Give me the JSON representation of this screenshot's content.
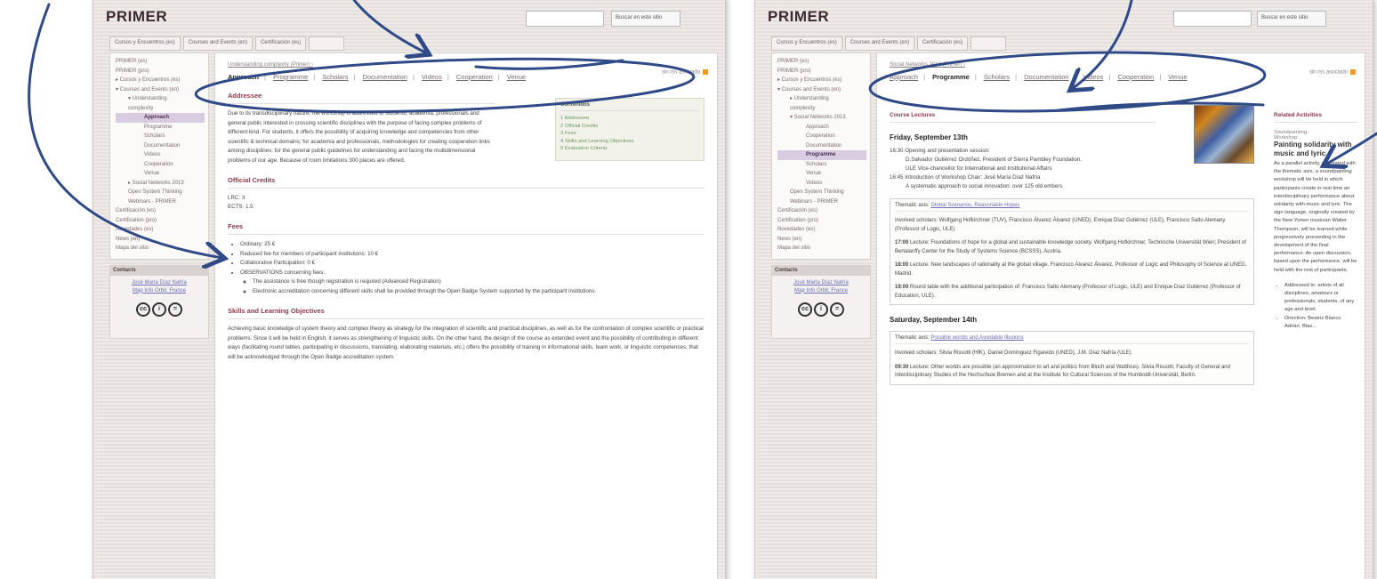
{
  "left": {
    "brand": "PRIMER",
    "search_select": "Buscar en este sitio",
    "top_tabs": [
      "Cursos y Encuentros (es)",
      "Courses and Events (en)",
      "Certificación (es)",
      ""
    ],
    "nav": [
      {
        "label": "PRIMER (es)",
        "level": 1
      },
      {
        "label": "PRIMER (pro)",
        "level": 1
      },
      {
        "label": "▸ Cursos y Encuentros (es)",
        "level": 1
      },
      {
        "label": "▾ Courses and Events (en)",
        "level": 1
      },
      {
        "label": "▾ Understanding",
        "level": 2
      },
      {
        "label": "complexity",
        "level": 2
      },
      {
        "label": "Approach",
        "level": 3,
        "active": true
      },
      {
        "label": "Programme",
        "level": 3
      },
      {
        "label": "Scholars",
        "level": 3
      },
      {
        "label": "Documentation",
        "level": 3
      },
      {
        "label": "Videos",
        "level": 3
      },
      {
        "label": "Cooperation",
        "level": 3
      },
      {
        "label": "Venue",
        "level": 3
      },
      {
        "label": "▸ Social Networks 2013",
        "level": 2
      },
      {
        "label": "Open System Thinking",
        "level": 2
      },
      {
        "label": "Webinars - PRIMER",
        "level": 2
      },
      {
        "label": "Certificación (es)",
        "level": 1
      },
      {
        "label": "Certification (pro)",
        "level": 1
      },
      {
        "label": "Novedades (es)",
        "level": 1
      },
      {
        "label": "News (en)",
        "level": 1
      },
      {
        "label": "Mapa del sitio",
        "level": 1
      }
    ],
    "contacts_title": "Contacts",
    "contacts_links": [
      "José María Díaz Nafría",
      "Map Info Orbit, France"
    ],
    "breadcrumb": "Understanding complexity (Primer) ›",
    "rss": "sin rss asociado",
    "subnav": [
      "Approach",
      "Programme",
      "Scholars",
      "Documentation",
      "Videos",
      "Cooperation",
      "Venue"
    ],
    "sections": {
      "addressee_h": "Addressee",
      "addressee_text": "Due to its transdisciplinary nature, the workshop is addressed to students, academia, professionals and general public interested in crossing scientific disciplines with the purpose of facing complex problems of different kind. For students, it offers the possibility of acquiring knowledge and competencies from other scientific & technical domains; for academia and professionals, methodologies for creating cooperation links among disciplines; for the general public guidelines for understanding and facing the multidimensional problems of our age. Because of room limitations 300 places are offered.",
      "credits_h": "Official Credits",
      "credits_lines": [
        "LRC: 3",
        "ECTS: 1.5"
      ],
      "fees_h": "Fees",
      "fees_items": [
        "Ordinary: 25 €",
        "Reduced fee for members of participant institutions: 10 €",
        "Collaborative Participation: 0 €",
        "OBSERVATIONS concerning fees:"
      ],
      "fees_sub": [
        "The assistance is free though registration is required (Advanced Registration)",
        "Electronic accreditation concerning different skills shall be provided through the Open Badge System supported by the participant institutions."
      ],
      "skills_h": "Skills and Learning Objectives",
      "skills_text": "Achieving basic knowledge of system theory and complex theory as strategy for the integration of scientific and practical disciplines, as well as for the confrontation of complex scientific or practical problems. Since it will be held in English, it serves as strengthening of linguistic skills. On the other hand, the design of the course as extended event and the possibility of contributing in different ways (facilitating round tables, participating in discussions, translating, elaborating materials, etc.) offers the possibility of training in informational skills, team work, or linguistic competences, that will be acknowledged through the Open Badge accreditation system."
    },
    "toc": {
      "title": "Contenidos",
      "items": [
        "1 Addressee",
        "2 Official Credits",
        "3 Fees",
        "4 Skills and Learning Objectives",
        "5 Evaluation Criteria"
      ]
    }
  },
  "right": {
    "brand": "PRIMER",
    "search_select": "Buscar en este sitio",
    "top_tabs": [
      "Cursos y Encuentros (es)",
      "Courses and Events (en)",
      "Certificación (es)",
      ""
    ],
    "nav": [
      {
        "label": "PRIMER (es)",
        "level": 1
      },
      {
        "label": "PRIMER (pro)",
        "level": 1
      },
      {
        "label": "▸ Cursos y Encuentros (es)",
        "level": 1
      },
      {
        "label": "▾ Courses and Events (en)",
        "level": 1
      },
      {
        "label": "▸ Understanding",
        "level": 2
      },
      {
        "label": "complexity",
        "level": 2
      },
      {
        "label": "▾ Social Networks 2013",
        "level": 2
      },
      {
        "label": "Approach",
        "level": 3
      },
      {
        "label": "Cooperation",
        "level": 3
      },
      {
        "label": "Documentation",
        "level": 3
      },
      {
        "label": "Programme",
        "level": 3,
        "active": true
      },
      {
        "label": "Scholars",
        "level": 3
      },
      {
        "label": "Venue",
        "level": 3
      },
      {
        "label": "Videos",
        "level": 3
      },
      {
        "label": "Open System Thinking",
        "level": 2
      },
      {
        "label": "Webinars - PRIMER",
        "level": 2
      },
      {
        "label": "Certificación (es)",
        "level": 1
      },
      {
        "label": "Certification (pro)",
        "level": 1
      },
      {
        "label": "Novedades (es)",
        "level": 1
      },
      {
        "label": "News (en)",
        "level": 1
      },
      {
        "label": "Mapa del sitio",
        "level": 1
      }
    ],
    "contacts_title": "Contacts",
    "contacts_links": [
      "José María Díaz Nafría",
      "Map Info Orbit, France"
    ],
    "breadcrumb": "Social Networks 2013 (Primer) ›",
    "rss": "sin rss asociado",
    "subnav": [
      "Approach",
      "Programme",
      "Scholars",
      "Documentation",
      "Videos",
      "Cooperation",
      "Venue"
    ],
    "course_lectures_h": "Course Lectures",
    "friday_h": "Friday, September 13th",
    "friday_lines": [
      "16:30 Opening and presentation session:",
      "D.Salvador Gutiérrez Ordóñez, President of Sierra Pambley Foundation.",
      "ULE Vice-chancellor for International and Institutional Affairs",
      "16:45 Introduction of Workshop Chair: José María Díaz Nafría",
      "A systematic approach to social innovation: over 125 old embers"
    ],
    "box1": {
      "theme_label": "Thematic axis:",
      "theme_link": "Global Scenarios, Reasonable Hopes",
      "p1": "Involved scholars: Wolfgang Hofkirchner (TUV), Francisco Álvarez Álvarez (UNED), Enrique Díaz Gutiérrez (ULE), Francisco Salto Alemany (Professor of Logic, ULE)",
      "p2_time": "17:00",
      "p2": "Lecture: Foundations of hope for a global and sustainable knowledge society. Wolfgang Hofkirchner, Technische Universität Wien; President of Bertalanffy Center for the Study of Systems Science (BCSSS), Austria.",
      "p3_time": "18:00",
      "p3": "Lecture: New landscapes of rationality at the global village. Francisco Álvarez Álvarez, Professor of Logic and Philosophy of Science at UNED, Madrid.",
      "p4_time": "19:00",
      "p4": "Round table with the additional participation of: Francisco Salto Alemany (Professor of Logic, ULE) and Enrique Díaz Gutiérrez (Professor of Education, ULE)."
    },
    "saturday_h": "Saturday, September 14th",
    "box2": {
      "theme_label": "Thematic axis:",
      "theme_link": "Possible worlds and Avoidable Illusions",
      "p1": "Involved scholars: Silvia Rissotti (HfK), Daniel Domínguez Figaredo (UNED), J.M. Díaz Nafría (ULE)",
      "p2_time": "09:30",
      "p2": "Lecture: Other worlds are possible (an approximation to art and politics from Bloch and Watthius). Silvia Rissotti, Faculty of General and Interdisciplinary Studies of the Hochschule Bremen and at the Institute for Cultural Sciences of the Humboldt-Universität, Berlin."
    },
    "related": {
      "title": "Related Activities",
      "kicker": "Soundpainting",
      "kicker2": "Workshop:",
      "headline": "Painting solidarity with music and lyric",
      "text": "As a parallel activity, integrated with the thematic axis, a soundpainting workshop will be held in which participants create in real time an interdisciplinary performance about solidarity with music and lyric. The sign language, originally created by the New Yorker musician Walter Thompson, will be learned while progressively proceeding in the development of the final performance. An open discussion, based upon the performance, will be held with the rest of participants.",
      "list": [
        "Addressed to: artists of all disciplines, amateurs or professionals, students, of any age and level.",
        "Direction: Beatriz Blanco Adrián, Blas..."
      ]
    }
  },
  "colors": {
    "accent_heading": "#8a3a4a",
    "link": "#6a6fb8",
    "annotation_arrow": "#2f4a86",
    "rss_orange": "#f29a1e"
  }
}
